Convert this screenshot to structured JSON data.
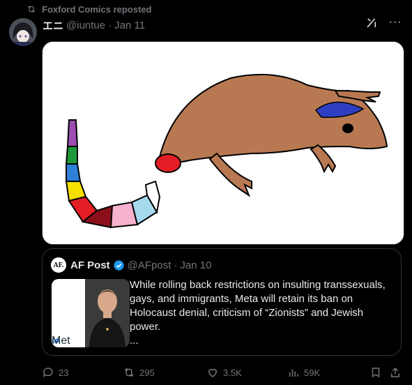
{
  "repost": {
    "text": "Foxford Comics reposted"
  },
  "post": {
    "display_name": "エニ",
    "handle": "@iuntue",
    "separator": "·",
    "date": "Jan 11"
  },
  "quote": {
    "logo_text": "AF.",
    "name": "AF Post",
    "handle": "@AFpost",
    "separator": "·",
    "date": "Jan 10",
    "image_text": "Met",
    "body": "While rolling back restrictions on insulting transsexuals, gays, and immigrants, Meta will retain its ban on Holocaust denial, criticism of “Zionists” and Jewish power.",
    "ellipsis": "..."
  },
  "actions": {
    "replies": "23",
    "reposts": "295",
    "likes": "3.5K",
    "views": "59K"
  },
  "colors": {
    "background": "#000000",
    "muted": "#71767b",
    "text": "#e7e9ea",
    "verified": "#1d9bf0",
    "lizard": "#b87952"
  }
}
